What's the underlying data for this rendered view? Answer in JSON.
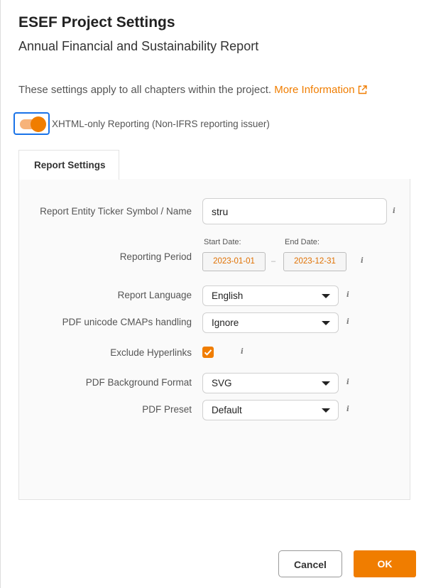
{
  "dialog": {
    "title": "ESEF Project Settings",
    "subtitle": "Annual Financial and Sustainability Report",
    "info_text": "These settings apply to all chapters within the project.",
    "info_link": "More Information",
    "toggle": {
      "label": "XHTML-only Reporting (Non-IFRS reporting issuer)",
      "on": true
    }
  },
  "tabs": [
    {
      "label": "Report Settings",
      "active": true
    }
  ],
  "form": {
    "ticker": {
      "label": "Report Entity Ticker Symbol / Name",
      "value": "stru"
    },
    "period": {
      "label": "Reporting Period",
      "start_caption": "Start Date:",
      "start_value": "2023-01-01",
      "end_caption": "End Date:",
      "end_value": "2023-12-31",
      "separator": "–"
    },
    "language": {
      "label": "Report Language",
      "value": "English"
    },
    "cmaps": {
      "label": "PDF unicode CMAPs handling",
      "value": "Ignore"
    },
    "hyperlinks": {
      "label": "Exclude Hyperlinks",
      "checked": true
    },
    "bg_format": {
      "label": "PDF Background Format",
      "value": "SVG"
    },
    "preset": {
      "label": "PDF Preset",
      "value": "Default"
    },
    "info_glyph": "i"
  },
  "buttons": {
    "cancel": "Cancel",
    "ok": "OK"
  },
  "colors": {
    "accent": "#f07d00",
    "focus": "#1a73e8"
  }
}
